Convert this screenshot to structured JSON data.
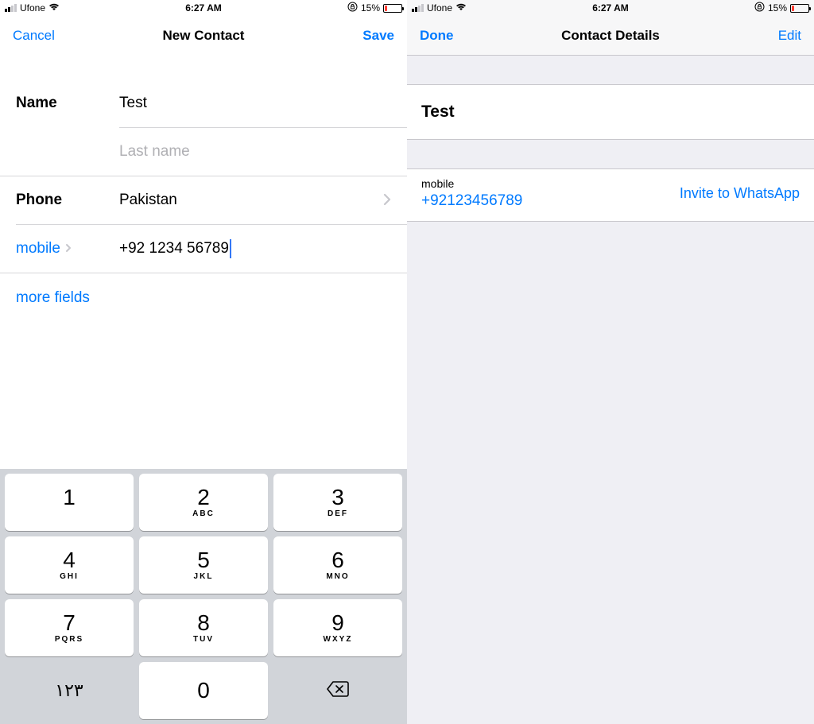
{
  "status": {
    "carrier": "Ufone",
    "time": "6:27 AM",
    "battery_pct": "15%"
  },
  "left": {
    "nav": {
      "cancel": "Cancel",
      "title": "New Contact",
      "save": "Save"
    },
    "labels": {
      "name": "Name",
      "phone": "Phone"
    },
    "fields": {
      "first_name_value": "Test",
      "last_name_placeholder": "Last name",
      "country": "Pakistan",
      "phone_type": "mobile",
      "phone_value": "+92   1234 56789"
    },
    "more_fields": "more fields",
    "keypad": {
      "keys": [
        {
          "digit": "1",
          "sub": ""
        },
        {
          "digit": "2",
          "sub": "ABC"
        },
        {
          "digit": "3",
          "sub": "DEF"
        },
        {
          "digit": "4",
          "sub": "GHI"
        },
        {
          "digit": "5",
          "sub": "JKL"
        },
        {
          "digit": "6",
          "sub": "MNO"
        },
        {
          "digit": "7",
          "sub": "PQRS"
        },
        {
          "digit": "8",
          "sub": "TUV"
        },
        {
          "digit": "9",
          "sub": "WXYZ"
        }
      ],
      "alt": "۱۲۳",
      "zero": "0"
    }
  },
  "right": {
    "nav": {
      "done": "Done",
      "title": "Contact Details",
      "edit": "Edit"
    },
    "contact_name": "Test",
    "phone_type": "mobile",
    "phone_number": "+92123456789",
    "invite": "Invite to WhatsApp"
  }
}
